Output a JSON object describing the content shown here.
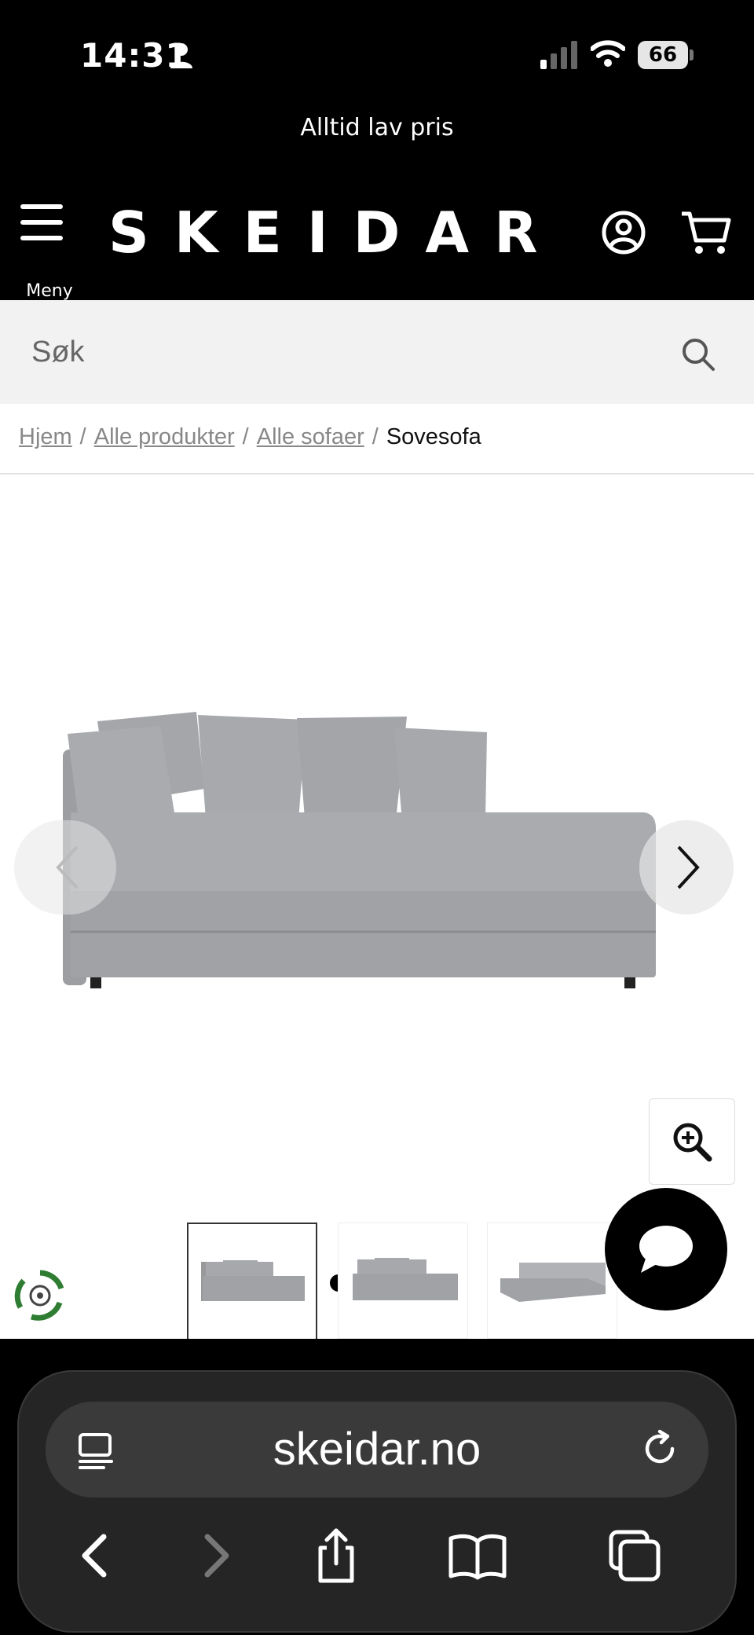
{
  "status": {
    "time": "14:31",
    "battery": "66"
  },
  "promo": {
    "text": "Alltid lav pris"
  },
  "header": {
    "logo": "SKEIDAR",
    "menu_label": "Meny"
  },
  "search": {
    "placeholder": "Søk"
  },
  "breadcrumb": {
    "items": [
      "Hjem",
      "Alle produkter",
      "Alle sofaer"
    ],
    "current": "Sovesofa"
  },
  "gallery": {
    "slide_count": 3,
    "active_slide": 1
  },
  "browser": {
    "url": "skeidar.no"
  },
  "colors": {
    "header_bg": "#000000",
    "search_bg": "#f2f2f2",
    "eco_green": "#2e7d32"
  }
}
